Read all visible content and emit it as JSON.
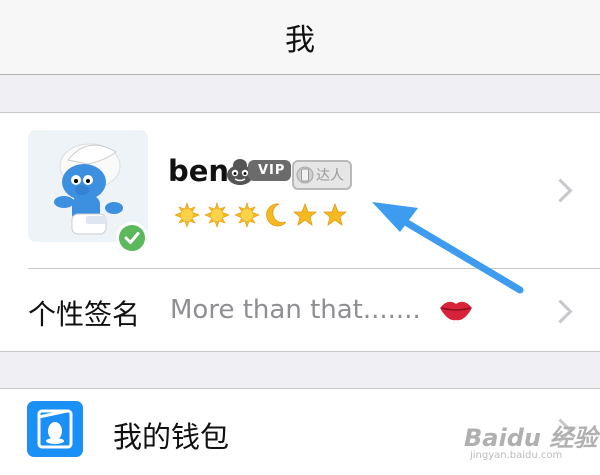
{
  "navbar": {
    "title": "我"
  },
  "profile": {
    "username": "ben",
    "vip_label": "VIP",
    "daren_label": "达人",
    "levels": [
      "sun",
      "sun",
      "sun",
      "moon",
      "star",
      "star"
    ],
    "verified": true
  },
  "signature": {
    "label": "个性签名",
    "value": "More than that.......",
    "emoji": "lips-icon"
  },
  "wallet": {
    "label": "我的钱包"
  },
  "watermark": {
    "brand": "Baidu 经验",
    "url": "jingyan.baidu.com"
  },
  "colors": {
    "accent": "#1a8ff5",
    "verified": "#5cb85c",
    "arrow": "#3d9bf0",
    "background": "#efeff4"
  }
}
